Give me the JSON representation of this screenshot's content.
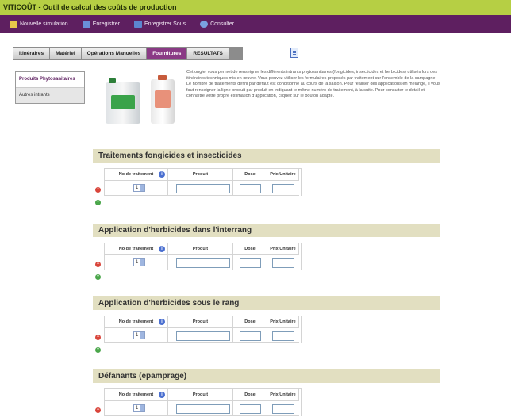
{
  "app": {
    "title": "VITICOÛT - Outil de calcul des coûts de production"
  },
  "menu": {
    "items": [
      {
        "label": "Nouvelle simulation",
        "icon": "new-doc-icon"
      },
      {
        "label": "Enregistrer",
        "icon": "save-icon"
      },
      {
        "label": "Enregistrer Sous",
        "icon": "save-as-icon"
      },
      {
        "label": "Consulter",
        "icon": "consult-icon"
      }
    ]
  },
  "tabs": [
    {
      "label": "Itinéraires",
      "active": false
    },
    {
      "label": "Matériel",
      "active": false
    },
    {
      "label": "Opérations Manuelles",
      "active": false
    },
    {
      "label": "Fournitures",
      "active": true
    },
    {
      "label": "RESULTATS",
      "active": false
    }
  ],
  "sidebar": {
    "items": [
      {
        "label": "Produits Phytosanitaires",
        "active": true
      },
      {
        "label": "Autres intrants",
        "active": false
      }
    ]
  },
  "description": "Cet onglet vous permet de renseigner les différents intrants phytosanitaires (fongicides, insecticides et herbicides) utilisés lors des itinéraires techniques mis en œuvre. Vous pouvez utiliser les formulaires proposés par traitement sur l'ensemble de la campagne. Le nombre de traitements défini par défaut est conditionné au cours de la saison. Pour réaliser des applications en mélange, il vous faut renseigner la ligne produit par produit en indiquant le même numéro de traitement, à la suite. Pour consulter le détail et connaître votre propre estimation d'application, cliquez sur le bouton adapté.",
  "table_headers": {
    "treatment_no": "No de traitement",
    "product": "Produit",
    "dose": "Dose",
    "unit_price": "Prix Unitaire"
  },
  "sections": [
    {
      "title": "Traitements fongicides et insecticides",
      "treatment_value": "1"
    },
    {
      "title": "Application d'herbicides dans l'interrang",
      "treatment_value": "1"
    },
    {
      "title": "Application d'herbicides sous le rang",
      "treatment_value": "1"
    },
    {
      "title": "Défanants (epamprage)",
      "treatment_value": "1"
    }
  ]
}
